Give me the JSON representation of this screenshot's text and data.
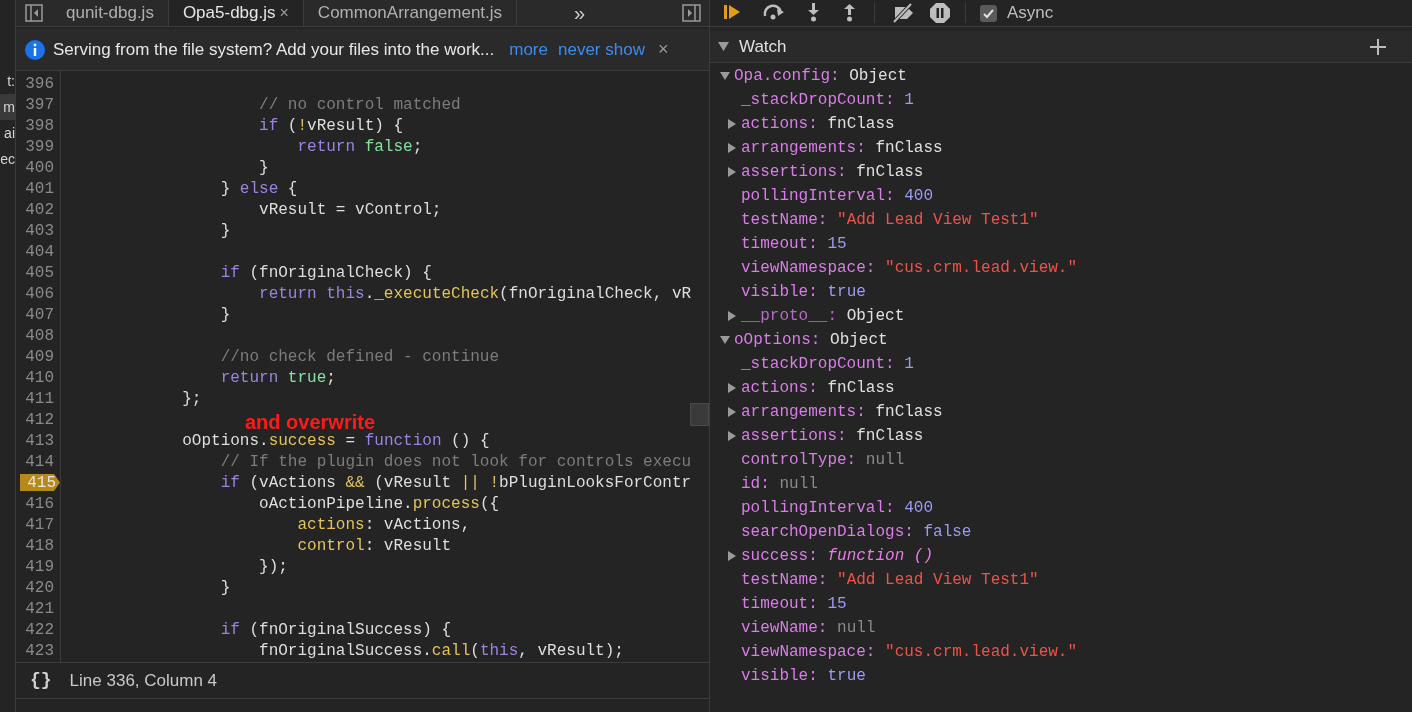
{
  "navigator_fragments": [
    {
      "text": "t:",
      "selected": false
    },
    {
      "text": "m",
      "selected": true
    },
    {
      "text": "ai",
      "selected": false
    },
    {
      "text": "ec",
      "selected": false
    }
  ],
  "editor_tabs": [
    {
      "label": "qunit-dbg.js",
      "selected": false
    },
    {
      "label": "Opa5-dbg.js",
      "selected": true,
      "close": "×"
    },
    {
      "label": "CommonArrangement.js",
      "selected": false
    }
  ],
  "editor_tabs_overflow": "»",
  "infobar": {
    "message": "Serving from the file system? Add your files into the work...",
    "links": [
      "more",
      "never show"
    ],
    "close": "×"
  },
  "code_lines": [
    {
      "num": "396",
      "breakpoint": false
    },
    {
      "num": "397",
      "breakpoint": false,
      "tokens": [
        {
          "text": "                    // no control matched",
          "kind": "comment"
        }
      ]
    },
    {
      "num": "398",
      "breakpoint": false,
      "tokens": [
        {
          "text": "                    if",
          "kind": "keyword"
        },
        {
          "text": " (",
          "kind": "plain"
        },
        {
          "text": "!",
          "kind": "accent"
        },
        {
          "text": "vResult) {",
          "kind": "plain"
        }
      ]
    },
    {
      "num": "399",
      "breakpoint": false,
      "tokens": [
        {
          "text": "                        return",
          "kind": "keyword"
        },
        {
          "text": " false",
          "kind": "literal"
        },
        {
          "text": ";",
          "kind": "plain"
        }
      ]
    },
    {
      "num": "400",
      "breakpoint": false,
      "tokens": [
        {
          "text": "                    }",
          "kind": "plain"
        }
      ]
    },
    {
      "num": "401",
      "breakpoint": false,
      "tokens": [
        {
          "text": "                } ",
          "kind": "plain"
        },
        {
          "text": "else",
          "kind": "keyword"
        },
        {
          "text": " {",
          "kind": "plain"
        }
      ]
    },
    {
      "num": "402",
      "breakpoint": false,
      "tokens": [
        {
          "text": "                    vResult = vControl;",
          "kind": "plain"
        }
      ]
    },
    {
      "num": "403",
      "breakpoint": false,
      "tokens": [
        {
          "text": "                }",
          "kind": "plain"
        }
      ]
    },
    {
      "num": "404",
      "breakpoint": false
    },
    {
      "num": "405",
      "breakpoint": false,
      "tokens": [
        {
          "text": "                if",
          "kind": "keyword"
        },
        {
          "text": " (fnOriginalCheck) {",
          "kind": "plain"
        }
      ]
    },
    {
      "num": "406",
      "breakpoint": false,
      "tokens": [
        {
          "text": "                    return",
          "kind": "keyword"
        },
        {
          "text": " this",
          "kind": "keyword"
        },
        {
          "text": ".",
          "kind": "plain"
        },
        {
          "text": "_executeCheck",
          "kind": "accent"
        },
        {
          "text": "(fnOriginalCheck, vR",
          "kind": "plain"
        }
      ]
    },
    {
      "num": "407",
      "breakpoint": false,
      "tokens": [
        {
          "text": "                }",
          "kind": "plain"
        }
      ]
    },
    {
      "num": "408",
      "breakpoint": false
    },
    {
      "num": "409",
      "breakpoint": false,
      "tokens": [
        {
          "text": "                //no check defined - continue",
          "kind": "comment"
        }
      ]
    },
    {
      "num": "410",
      "breakpoint": false,
      "tokens": [
        {
          "text": "                return",
          "kind": "keyword"
        },
        {
          "text": " true",
          "kind": "literal"
        },
        {
          "text": ";",
          "kind": "plain"
        }
      ]
    },
    {
      "num": "411",
      "breakpoint": false,
      "tokens": [
        {
          "text": "            };",
          "kind": "plain"
        }
      ]
    },
    {
      "num": "412",
      "breakpoint": false,
      "annotation": "and overwrite"
    },
    {
      "num": "413",
      "breakpoint": false,
      "tokens": [
        {
          "text": "            oOptions.",
          "kind": "plain"
        },
        {
          "text": "success",
          "kind": "accent"
        },
        {
          "text": " = ",
          "kind": "plain"
        },
        {
          "text": "function",
          "kind": "keyword"
        },
        {
          "text": " () {",
          "kind": "plain"
        }
      ]
    },
    {
      "num": "414",
      "breakpoint": false,
      "tokens": [
        {
          "text": "                // If the plugin does not look for controls execu",
          "kind": "comment"
        }
      ]
    },
    {
      "num": "415",
      "breakpoint": true,
      "tokens": [
        {
          "text": "                if",
          "kind": "keyword"
        },
        {
          "text": " (vActions ",
          "kind": "plain"
        },
        {
          "text": "&&",
          "kind": "accent"
        },
        {
          "text": " (vResult ",
          "kind": "plain"
        },
        {
          "text": "||",
          "kind": "accent"
        },
        {
          "text": " !",
          "kind": "accent"
        },
        {
          "text": "bPluginLooksForContr",
          "kind": "plain"
        }
      ]
    },
    {
      "num": "416",
      "breakpoint": false,
      "tokens": [
        {
          "text": "                    oActionPipeline.",
          "kind": "plain"
        },
        {
          "text": "process",
          "kind": "accent"
        },
        {
          "text": "({",
          "kind": "plain"
        }
      ]
    },
    {
      "num": "417",
      "breakpoint": false,
      "tokens": [
        {
          "text": "                        actions",
          "kind": "accent"
        },
        {
          "text": ": vActions,",
          "kind": "plain"
        }
      ]
    },
    {
      "num": "418",
      "breakpoint": false,
      "tokens": [
        {
          "text": "                        control",
          "kind": "accent"
        },
        {
          "text": ": vResult",
          "kind": "plain"
        }
      ]
    },
    {
      "num": "419",
      "breakpoint": false,
      "tokens": [
        {
          "text": "                    });",
          "kind": "plain"
        }
      ]
    },
    {
      "num": "420",
      "breakpoint": false,
      "tokens": [
        {
          "text": "                }",
          "kind": "plain"
        }
      ]
    },
    {
      "num": "421",
      "breakpoint": false
    },
    {
      "num": "422",
      "breakpoint": false,
      "tokens": [
        {
          "text": "                if",
          "kind": "keyword"
        },
        {
          "text": " (fnOriginalSuccess) {",
          "kind": "plain"
        }
      ]
    },
    {
      "num": "423",
      "breakpoint": false,
      "tokens": [
        {
          "text": "                    fnOriginalSuccess.",
          "kind": "plain"
        },
        {
          "text": "call",
          "kind": "accent"
        },
        {
          "text": "(",
          "kind": "plain"
        },
        {
          "text": "this",
          "kind": "keyword"
        },
        {
          "text": ", vResult);",
          "kind": "plain"
        }
      ]
    }
  ],
  "status_bar": {
    "pretty_print": "{}",
    "position": "Line 336, Column 4"
  },
  "debug_toolbar": {
    "async": {
      "label": "Async",
      "checked": true
    }
  },
  "watch": {
    "title": "Watch",
    "expanded": true,
    "items": [
      {
        "name": "Opa.config:",
        "value": "Object",
        "kind": "object",
        "expanded": true,
        "children": [
          {
            "name": "_stackDropCount:",
            "value": "1",
            "kind": "number"
          },
          {
            "name": "actions:",
            "value": "fnClass",
            "kind": "object",
            "expanded": false
          },
          {
            "name": "arrangements:",
            "value": "fnClass",
            "kind": "object",
            "expanded": false
          },
          {
            "name": "assertions:",
            "value": "fnClass",
            "kind": "object",
            "expanded": false
          },
          {
            "name": "pollingInterval:",
            "value": "400",
            "kind": "number"
          },
          {
            "name": "testName:",
            "value": "\"Add Lead View Test1\"",
            "kind": "string"
          },
          {
            "name": "timeout:",
            "value": "15",
            "kind": "number"
          },
          {
            "name": "viewNamespace:",
            "value": "\"cus.crm.lead.view.\"",
            "kind": "string"
          },
          {
            "name": "visible:",
            "value": "true",
            "kind": "number"
          },
          {
            "name": "__proto__:",
            "value": "Object",
            "kind": "internal",
            "expanded": false
          }
        ]
      },
      {
        "name": "oOptions:",
        "value": "Object",
        "kind": "object",
        "expanded": true,
        "children": [
          {
            "name": "_stackDropCount:",
            "value": "1",
            "kind": "number"
          },
          {
            "name": "actions:",
            "value": "fnClass",
            "kind": "object",
            "expanded": false
          },
          {
            "name": "arrangements:",
            "value": "fnClass",
            "kind": "object",
            "expanded": false
          },
          {
            "name": "assertions:",
            "value": "fnClass",
            "kind": "object",
            "expanded": false
          },
          {
            "name": "controlType:",
            "value": "null",
            "kind": "null"
          },
          {
            "name": "id:",
            "value": "null",
            "kind": "null"
          },
          {
            "name": "pollingInterval:",
            "value": "400",
            "kind": "number"
          },
          {
            "name": "searchOpenDialogs:",
            "value": "false",
            "kind": "number"
          },
          {
            "name": "success:",
            "value": "function ()",
            "kind": "function",
            "expanded": false
          },
          {
            "name": "testName:",
            "value": "\"Add Lead View Test1\"",
            "kind": "string"
          },
          {
            "name": "timeout:",
            "value": "15",
            "kind": "number"
          },
          {
            "name": "viewName:",
            "value": "null",
            "kind": "null"
          },
          {
            "name": "viewNamespace:",
            "value": "\"cus.crm.lead.view.\"",
            "kind": "string"
          },
          {
            "name": "visible:",
            "value": "true",
            "kind": "number"
          }
        ]
      }
    ]
  }
}
